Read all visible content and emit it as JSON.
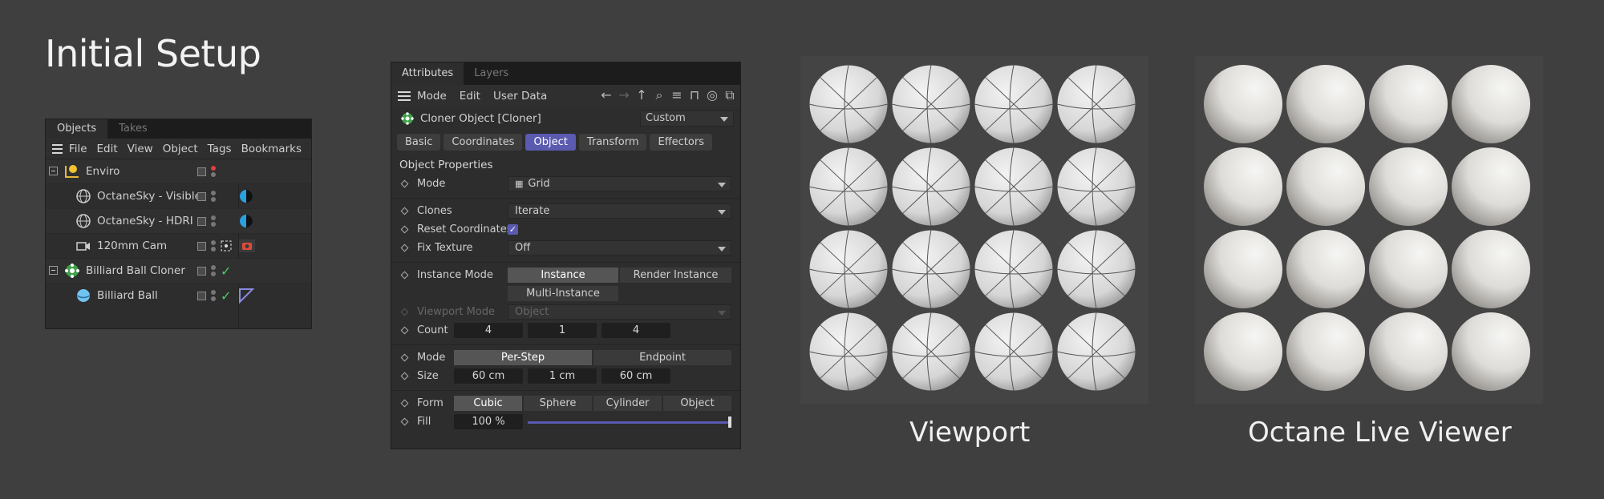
{
  "title": "Initial Setup",
  "objects_manager": {
    "tabs": [
      "Objects",
      "Takes"
    ],
    "menu": [
      "File",
      "Edit",
      "View",
      "Object",
      "Tags",
      "Bookmarks"
    ],
    "rows": [
      {
        "name": "Enviro",
        "indent": 0,
        "icon": "null-object-icon"
      },
      {
        "name": "OctaneSky - Visible",
        "indent": 1,
        "icon": "sky-icon"
      },
      {
        "name": "OctaneSky - HDRI",
        "indent": 1,
        "icon": "sky-icon"
      },
      {
        "name": "120mm Cam",
        "indent": 1,
        "icon": "camera-icon"
      },
      {
        "name": "Billiard Ball Cloner",
        "indent": 0,
        "icon": "cloner-icon"
      },
      {
        "name": "Billiard Ball",
        "indent": 1,
        "icon": "sphere-icon"
      }
    ]
  },
  "attributes": {
    "tabs": [
      "Attributes",
      "Layers"
    ],
    "menu": [
      "Mode",
      "Edit",
      "User Data"
    ],
    "object_name": "Cloner Object [Cloner]",
    "preset": "Custom",
    "tabs2": [
      "Basic",
      "Coordinates",
      "Object",
      "Transform",
      "Effectors"
    ],
    "section": "Object Properties",
    "mode_label": "Mode",
    "mode_value": "Grid",
    "clones_label": "Clones",
    "clones_value": "Iterate",
    "reset_label": "Reset Coordinates",
    "fix_label": "Fix Texture",
    "fix_value": "Off",
    "instance_label": "Instance Mode",
    "instance_opts": [
      "Instance",
      "Render Instance",
      "Multi-Instance"
    ],
    "viewport_label": "Viewport Mode",
    "viewport_value": "Object",
    "count_label": "Count",
    "count": [
      "4",
      "1",
      "4"
    ],
    "mode2_label": "Mode",
    "mode2_opts": [
      "Per-Step",
      "Endpoint"
    ],
    "size_label": "Size",
    "size": [
      "60 cm",
      "1 cm",
      "60 cm"
    ],
    "form_label": "Form",
    "form_opts": [
      "Cubic",
      "Sphere",
      "Cylinder",
      "Object"
    ],
    "fill_label": "Fill",
    "fill_value": "100 %",
    "fill_fraction": 1.0
  },
  "captions": {
    "viewport": "Viewport",
    "live": "Octane Live Viewer"
  }
}
